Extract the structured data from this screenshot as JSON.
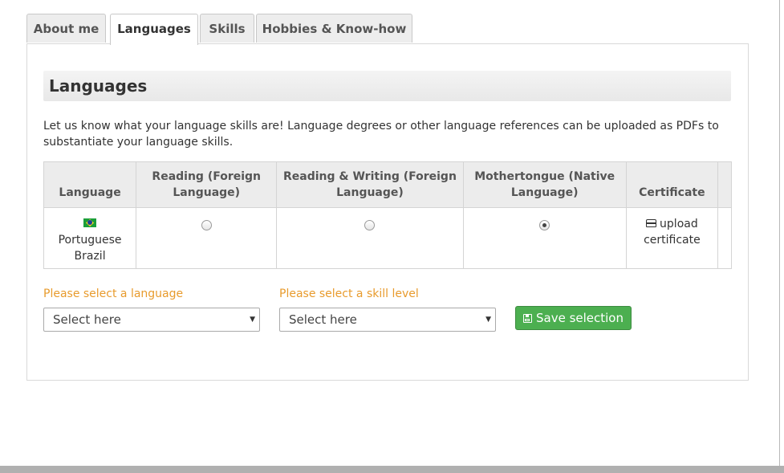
{
  "tabs": [
    {
      "label": "About me",
      "active": false
    },
    {
      "label": "Languages",
      "active": true
    },
    {
      "label": "Skills",
      "active": false
    },
    {
      "label": "Hobbies & Know-how",
      "active": false
    }
  ],
  "section": {
    "title": "Languages",
    "intro": "Let us know what your language skills are! Language degrees or other language references can be uploaded as PDFs to substantiate your language skills."
  },
  "table": {
    "headers": [
      "Language",
      "Reading (Foreign Language)",
      "Reading & Writing (Foreign Language)",
      "Mothertongue (Native Language)",
      "Certificate"
    ],
    "rows": [
      {
        "language": "Portuguese Brazil",
        "flag_icon": "brazil-flag-icon",
        "level_selected": "Mothertongue (Native Language)",
        "certificate_label": "upload certificate"
      }
    ]
  },
  "form": {
    "language_label": "Please select a language",
    "language_value": "Select here",
    "skill_label": "Please select a skill level",
    "skill_value": "Select here",
    "save_label": "Save selection"
  },
  "colors": {
    "label_orange": "#e89b2d",
    "save_green": "#4caf50"
  }
}
